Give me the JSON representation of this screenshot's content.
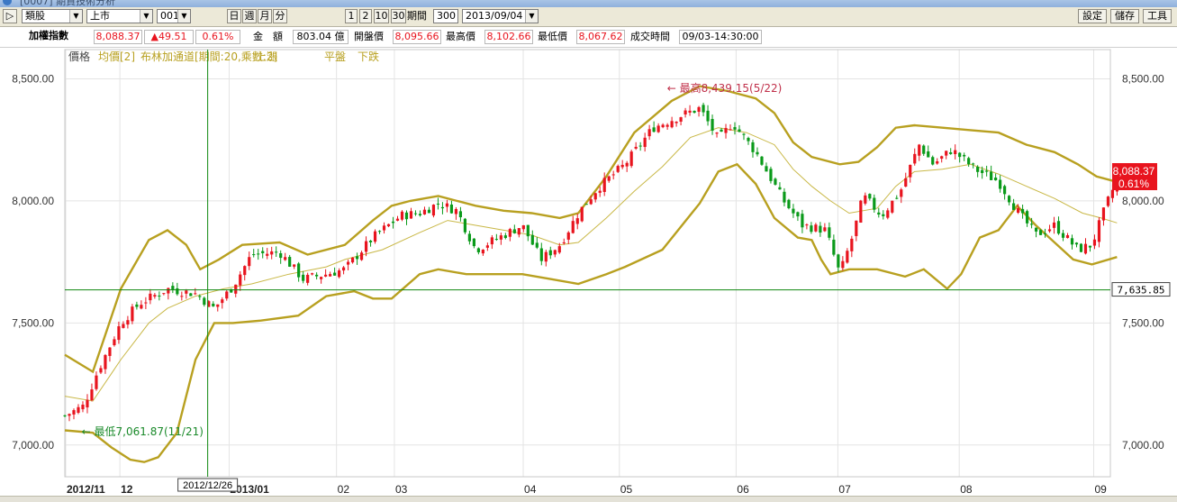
{
  "window": {
    "title": "[0007] 期貨技術分析"
  },
  "toolbar": {
    "category": "類股",
    "market": "上市",
    "code": "001",
    "periods": [
      "日",
      "週",
      "月",
      "分"
    ],
    "ranges": [
      "1",
      "2",
      "10",
      "30"
    ],
    "period_label": "期間",
    "period_value": "300",
    "date_value": "2013/09/04",
    "settings_label": "設定",
    "save_label": "儲存",
    "tools_label": "工具"
  },
  "quote": {
    "name": "加權指數",
    "price": "8,088.37",
    "change": "▲49.51",
    "change_pct": "0.61%",
    "amount_label": "金　額",
    "amount_value": "803.04 億",
    "open_label": "開盤價",
    "open_value": "8,095.66",
    "high_label": "最高價",
    "high_value": "8,102.66",
    "low_label": "最低價",
    "low_value": "8,067.62",
    "time_label": "成交時間",
    "time_value": "09/03-14:30:00"
  },
  "colors": {
    "up": "#e8141e",
    "down": "#0a9a1a",
    "band": "#b8a020",
    "ma": "#c9b847",
    "crosshair": "#118811",
    "grid": "#e4e4e4",
    "price_box": "#e8141e"
  },
  "chart_data": {
    "type": "candlestick",
    "legend": [
      "價格",
      "均價[2]",
      "布林加通道[期間:20,乘數:2]",
      "上漲",
      "平盤",
      "下跌"
    ],
    "y_ticks": [
      "8,500.00",
      "8,000.00",
      "7,500.00",
      "7,000.00"
    ],
    "ylim": [
      6870,
      8620
    ],
    "x_labels": [
      "2012/11",
      "12",
      "2013/01",
      "02",
      "03",
      "04",
      "05",
      "06",
      "07",
      "08",
      "09"
    ],
    "crosshair": {
      "date": "2012/12/26",
      "value": "7,635.85"
    },
    "last": {
      "value": "8,088.37",
      "pct": "0.61%"
    },
    "high_annotation": "最高8,439.15(5/22)",
    "low_annotation": "最低7,061.87(11/21)",
    "trend": [
      [
        0.0,
        7120
      ],
      [
        0.02,
        7160
      ],
      [
        0.035,
        7300
      ],
      [
        0.06,
        7500
      ],
      [
        0.08,
        7580
      ],
      [
        0.11,
        7640
      ],
      [
        0.14,
        7620
      ],
      [
        0.16,
        7560
      ],
      [
        0.18,
        7650
      ],
      [
        0.2,
        7780
      ],
      [
        0.23,
        7790
      ],
      [
        0.255,
        7680
      ],
      [
        0.28,
        7700
      ],
      [
        0.3,
        7720
      ],
      [
        0.33,
        7850
      ],
      [
        0.36,
        7940
      ],
      [
        0.38,
        7950
      ],
      [
        0.4,
        7990
      ],
      [
        0.42,
        7960
      ],
      [
        0.44,
        7800
      ],
      [
        0.47,
        7860
      ],
      [
        0.49,
        7900
      ],
      [
        0.51,
        7760
      ],
      [
        0.53,
        7820
      ],
      [
        0.55,
        7950
      ],
      [
        0.57,
        8050
      ],
      [
        0.6,
        8150
      ],
      [
        0.63,
        8300
      ],
      [
        0.66,
        8350
      ],
      [
        0.68,
        8380
      ],
      [
        0.7,
        8250
      ],
      [
        0.715,
        8320
      ],
      [
        0.74,
        8200
      ],
      [
        0.77,
        8000
      ],
      [
        0.79,
        7900
      ],
      [
        0.815,
        7880
      ],
      [
        0.83,
        7700
      ],
      [
        0.845,
        7870
      ],
      [
        0.855,
        8020
      ],
      [
        0.875,
        7940
      ],
      [
        0.895,
        8040
      ],
      [
        0.915,
        8230
      ],
      [
        0.93,
        8150
      ],
      [
        0.95,
        8210
      ],
      [
        0.975,
        8130
      ],
      [
        1.0,
        8080
      ],
      [
        1.02,
        7960
      ],
      [
        1.04,
        7860
      ],
      [
        1.06,
        7900
      ],
      [
        1.085,
        7800
      ],
      [
        1.1,
        7820
      ],
      [
        1.115,
        7980
      ],
      [
        1.127,
        8088
      ]
    ],
    "upper_band": [
      [
        0.0,
        7370
      ],
      [
        0.03,
        7300
      ],
      [
        0.06,
        7640
      ],
      [
        0.09,
        7840
      ],
      [
        0.11,
        7880
      ],
      [
        0.13,
        7820
      ],
      [
        0.145,
        7720
      ],
      [
        0.165,
        7760
      ],
      [
        0.19,
        7820
      ],
      [
        0.23,
        7830
      ],
      [
        0.26,
        7780
      ],
      [
        0.3,
        7820
      ],
      [
        0.33,
        7920
      ],
      [
        0.35,
        7980
      ],
      [
        0.37,
        8000
      ],
      [
        0.4,
        8020
      ],
      [
        0.44,
        7980
      ],
      [
        0.47,
        7960
      ],
      [
        0.5,
        7950
      ],
      [
        0.53,
        7930
      ],
      [
        0.55,
        7950
      ],
      [
        0.58,
        8100
      ],
      [
        0.61,
        8280
      ],
      [
        0.65,
        8410
      ],
      [
        0.68,
        8470
      ],
      [
        0.71,
        8450
      ],
      [
        0.74,
        8420
      ],
      [
        0.76,
        8360
      ],
      [
        0.78,
        8240
      ],
      [
        0.8,
        8180
      ],
      [
        0.83,
        8150
      ],
      [
        0.85,
        8160
      ],
      [
        0.87,
        8220
      ],
      [
        0.89,
        8300
      ],
      [
        0.91,
        8310
      ],
      [
        0.94,
        8300
      ],
      [
        0.97,
        8290
      ],
      [
        1.0,
        8280
      ],
      [
        1.03,
        8230
      ],
      [
        1.06,
        8200
      ],
      [
        1.085,
        8150
      ],
      [
        1.105,
        8100
      ],
      [
        1.125,
        8080
      ]
    ],
    "lower_band": [
      [
        0.0,
        7060
      ],
      [
        0.03,
        7050
      ],
      [
        0.05,
        6990
      ],
      [
        0.07,
        6940
      ],
      [
        0.085,
        6930
      ],
      [
        0.1,
        6950
      ],
      [
        0.12,
        7050
      ],
      [
        0.14,
        7350
      ],
      [
        0.16,
        7500
      ],
      [
        0.18,
        7500
      ],
      [
        0.21,
        7510
      ],
      [
        0.25,
        7530
      ],
      [
        0.28,
        7610
      ],
      [
        0.31,
        7630
      ],
      [
        0.33,
        7600
      ],
      [
        0.35,
        7600
      ],
      [
        0.38,
        7700
      ],
      [
        0.4,
        7720
      ],
      [
        0.43,
        7700
      ],
      [
        0.46,
        7700
      ],
      [
        0.49,
        7700
      ],
      [
        0.52,
        7680
      ],
      [
        0.55,
        7660
      ],
      [
        0.58,
        7700
      ],
      [
        0.6,
        7730
      ],
      [
        0.64,
        7800
      ],
      [
        0.68,
        7990
      ],
      [
        0.7,
        8120
      ],
      [
        0.72,
        8150
      ],
      [
        0.74,
        8070
      ],
      [
        0.76,
        7930
      ],
      [
        0.785,
        7850
      ],
      [
        0.8,
        7840
      ],
      [
        0.81,
        7760
      ],
      [
        0.82,
        7700
      ],
      [
        0.84,
        7720
      ],
      [
        0.87,
        7720
      ],
      [
        0.9,
        7690
      ],
      [
        0.92,
        7720
      ],
      [
        0.945,
        7640
      ],
      [
        0.96,
        7700
      ],
      [
        0.98,
        7850
      ],
      [
        1.0,
        7880
      ],
      [
        1.02,
        7980
      ],
      [
        1.04,
        7900
      ],
      [
        1.06,
        7830
      ],
      [
        1.08,
        7760
      ],
      [
        1.1,
        7740
      ],
      [
        1.127,
        7770
      ]
    ],
    "ma": [
      [
        0.0,
        7200
      ],
      [
        0.03,
        7180
      ],
      [
        0.06,
        7350
      ],
      [
        0.09,
        7500
      ],
      [
        0.11,
        7560
      ],
      [
        0.14,
        7610
      ],
      [
        0.17,
        7640
      ],
      [
        0.2,
        7660
      ],
      [
        0.24,
        7700
      ],
      [
        0.28,
        7730
      ],
      [
        0.3,
        7760
      ],
      [
        0.34,
        7800
      ],
      [
        0.38,
        7870
      ],
      [
        0.41,
        7920
      ],
      [
        0.44,
        7900
      ],
      [
        0.47,
        7880
      ],
      [
        0.5,
        7860
      ],
      [
        0.53,
        7820
      ],
      [
        0.55,
        7830
      ],
      [
        0.58,
        7930
      ],
      [
        0.61,
        8040
      ],
      [
        0.64,
        8140
      ],
      [
        0.67,
        8260
      ],
      [
        0.7,
        8300
      ],
      [
        0.73,
        8280
      ],
      [
        0.76,
        8230
      ],
      [
        0.78,
        8130
      ],
      [
        0.8,
        8060
      ],
      [
        0.82,
        8000
      ],
      [
        0.84,
        7950
      ],
      [
        0.87,
        7970
      ],
      [
        0.89,
        8060
      ],
      [
        0.91,
        8120
      ],
      [
        0.94,
        8130
      ],
      [
        0.97,
        8150
      ],
      [
        1.0,
        8110
      ],
      [
        1.03,
        8060
      ],
      [
        1.06,
        8010
      ],
      [
        1.09,
        7950
      ],
      [
        1.11,
        7930
      ],
      [
        1.127,
        7910
      ]
    ]
  }
}
